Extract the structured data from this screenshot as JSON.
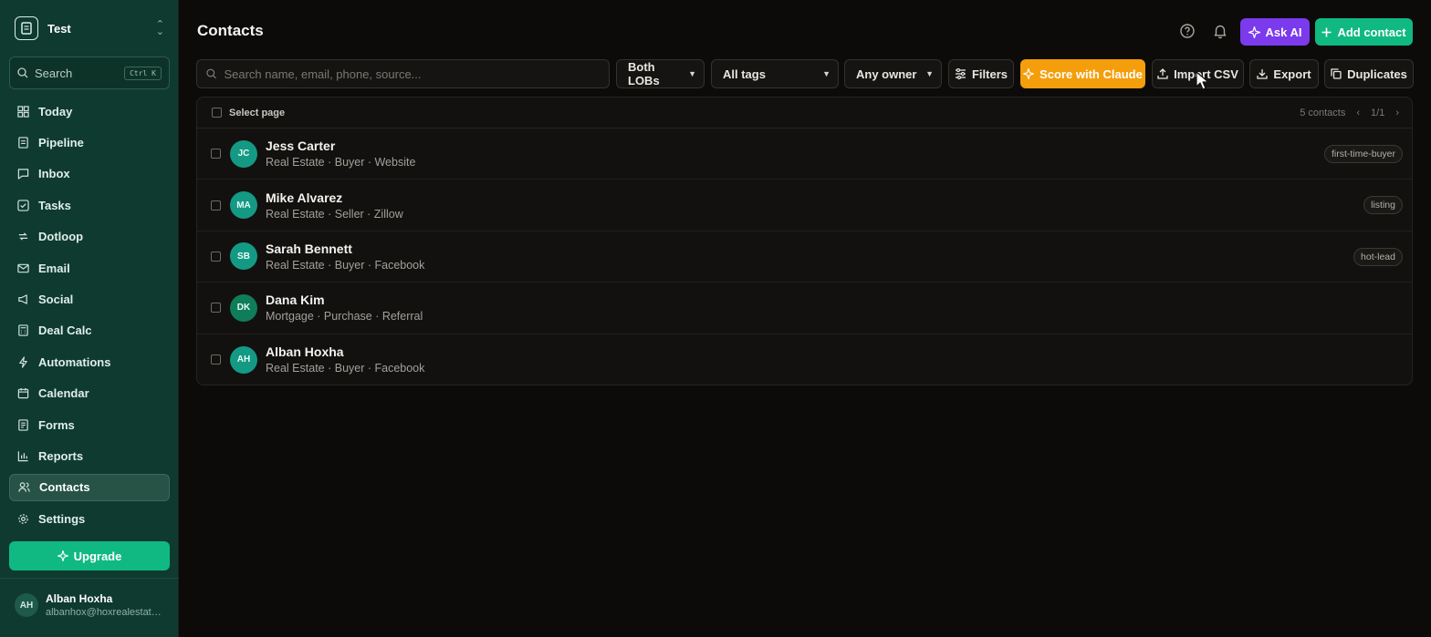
{
  "sidebar": {
    "workspace": "Test",
    "search": {
      "label": "Search",
      "shortcut": "Ctrl K"
    },
    "items": [
      {
        "label": "Today",
        "icon": "dashboard-icon"
      },
      {
        "label": "Pipeline",
        "icon": "document-icon"
      },
      {
        "label": "Inbox",
        "icon": "message-icon"
      },
      {
        "label": "Tasks",
        "icon": "checkbox-icon"
      },
      {
        "label": "Dotloop",
        "icon": "loop-icon"
      },
      {
        "label": "Email",
        "icon": "mail-icon"
      },
      {
        "label": "Social",
        "icon": "megaphone-icon"
      },
      {
        "label": "Deal Calc",
        "icon": "calculator-icon"
      },
      {
        "label": "Automations",
        "icon": "bolt-icon"
      },
      {
        "label": "Calendar",
        "icon": "calendar-icon"
      },
      {
        "label": "Forms",
        "icon": "form-icon"
      },
      {
        "label": "Reports",
        "icon": "chart-icon"
      },
      {
        "label": "Contacts",
        "icon": "users-icon",
        "active": true
      },
      {
        "label": "Settings",
        "icon": "gear-icon"
      }
    ],
    "upgrade": "Upgrade",
    "user": {
      "initials": "AH",
      "name": "Alban Hoxha",
      "email": "albanhox@hoxrealestate...."
    }
  },
  "header": {
    "title": "Contacts",
    "ask_ai": "Ask AI",
    "add_contact": "Add contact"
  },
  "toolbar": {
    "search_placeholder": "Search name, email, phone, source...",
    "lob": "Both LOBs",
    "tags": "All tags",
    "owner": "Any owner",
    "filters": "Filters",
    "score": "Score with Claude",
    "import": "Import CSV",
    "export": "Export",
    "duplicates": "Duplicates"
  },
  "table": {
    "select_page": "Select page",
    "count": "5 contacts",
    "page": "1/1",
    "rows": [
      {
        "initials": "JC",
        "name": "Jess Carter",
        "meta": "Real Estate · Buyer · Website",
        "tag": "first-time-buyer"
      },
      {
        "initials": "MA",
        "name": "Mike Alvarez",
        "meta": "Real Estate · Seller · Zillow",
        "tag": "listing"
      },
      {
        "initials": "SB",
        "name": "Sarah Bennett",
        "meta": "Real Estate · Buyer · Facebook",
        "tag": "hot-lead"
      },
      {
        "initials": "DK",
        "name": "Dana Kim",
        "meta": "Mortgage · Purchase · Referral",
        "tag": ""
      },
      {
        "initials": "AH",
        "name": "Alban Hoxha",
        "meta": "Real Estate · Buyer · Facebook",
        "tag": ""
      }
    ]
  },
  "colors": {
    "sidebar_bg": "#0f3a30",
    "accent_green": "#10b981",
    "ai_purple": "#7c3aed",
    "claude_orange": "#f59e0b",
    "page_bg": "#0c0b09"
  }
}
